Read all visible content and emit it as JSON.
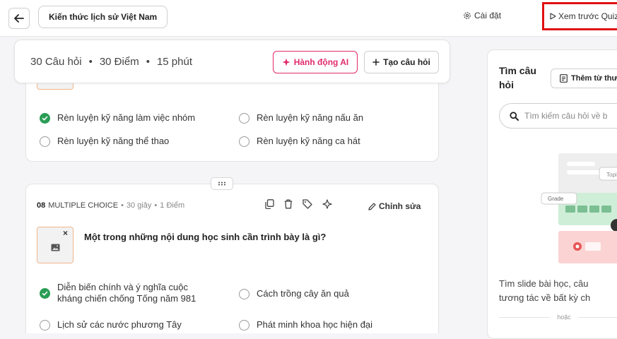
{
  "header": {
    "back_icon": "arrow-left-icon",
    "title": "Kiến thức lịch sử Việt Nam",
    "settings_label": "Cài đặt",
    "preview_label": "Xem trước Quiz"
  },
  "summary": {
    "questions": "30 Câu hỏi",
    "points": "30 Điểm",
    "duration": "15 phút",
    "separator": "•",
    "ai_action_label": "Hành động AI",
    "create_question_label": "Tạo câu hỏi"
  },
  "question7": {
    "options": [
      {
        "text": "Rèn luyện kỹ năng làm việc nhóm",
        "correct": true
      },
      {
        "text": "Rèn luyện kỹ năng nấu ăn",
        "correct": false
      },
      {
        "text": "Rèn luyện kỹ năng thể thao",
        "correct": false
      },
      {
        "text": "Rèn luyện kỹ năng ca hát",
        "correct": false
      }
    ]
  },
  "question8": {
    "number": "08",
    "type": "MULTIPLE CHOICE",
    "time": "30 giây",
    "points": "1 Điểm",
    "sep": "•",
    "edit_label": "Chỉnh sửa",
    "close": "×",
    "text": "Một trong những nội dung học sinh cần trình bày là gì?",
    "options": [
      {
        "text": "Diễn biến chính và ý nghĩa cuộc kháng chiến chống Tống năm 981",
        "correct": true
      },
      {
        "text": "Cách trồng cây ăn quả",
        "correct": false
      },
      {
        "text": "Lịch sử các nước phương Tây",
        "correct": false
      },
      {
        "text": "Phát minh khoa học hiện đại",
        "correct": false
      }
    ]
  },
  "sidebar": {
    "title": "Tìm câu hỏi",
    "library_label": "Thêm từ thư",
    "search_placeholder": "Tìm kiếm câu hỏi về b",
    "illustration_tags": {
      "topic": "Topi",
      "grade": "Grade"
    },
    "description_line1": "Tìm slide bài học, câu",
    "description_line2": "tương tác về bất kỳ ch",
    "or_label": "hoặc"
  },
  "colors": {
    "accent_pink": "#e02a6b",
    "correct_green": "#2a9d55",
    "highlight_red": "#e01010"
  }
}
